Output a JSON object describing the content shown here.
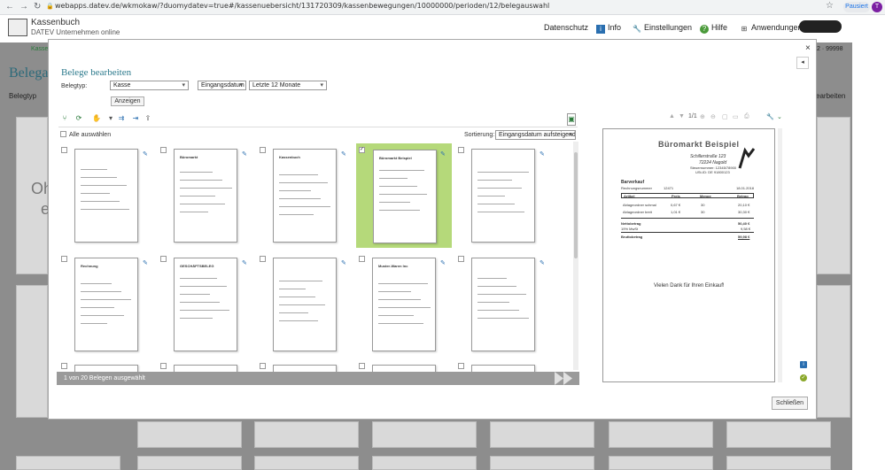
{
  "browser": {
    "url": "webapps.datev.de/wkmokaw/?duomydatev=true#/kassenuebersicht/131720309/kassenbewegungen/10000000/perioden/12/belegauswahl",
    "paused_label": "Pausiert",
    "avatar_letter": "T"
  },
  "app": {
    "title": "Kassenbuch",
    "subtitle": "DATEV Unternehmen online",
    "nav": [
      "Datenschutz",
      "Info",
      "Einstellungen",
      "Hilfe",
      "Anwendungen"
    ]
  },
  "background": {
    "tab_text": "Kassen",
    "number_text": "2 · 99998",
    "page_title": "Belega",
    "belegtyp_label": "Belegtyp",
    "arbeiten_label": "earbeiten",
    "oh_text": "Oh",
    "e_text": "e"
  },
  "modal": {
    "title": "Belege bearbeiten",
    "belegtyp_label": "Belegtyp:",
    "belegtyp_value": "Kasse",
    "date_field_value": "Eingangsdatum",
    "period_value": "Letzte 12 Monate",
    "show_button": "Anzeigen",
    "select_all_label": "Alle auswählen",
    "sort_label": "Sortierung:",
    "sort_value": "Eingangsdatum aufsteigend",
    "status_text": "1 von 20 Belegen ausgewählt",
    "close_button": "Schließen",
    "page_indicator": "1/1"
  },
  "thumbnails": {
    "total": 20,
    "selected_index": 3,
    "headings": [
      "",
      "Büromarkt",
      "Kassenbuch",
      "Büromarkt Beispiel",
      "",
      "Rechnung",
      "GESCHÄFTSBELEG",
      "",
      "Muster-Waren Inc",
      ""
    ]
  },
  "preview": {
    "company": "Büromarkt Beispiel",
    "address_lines": [
      "Schillerstraße 123",
      "72224 Nagold",
      "Steuernummer: 12345/78900",
      "USt-ID: DE 91800123"
    ],
    "doc_type": "Barverkauf",
    "receipt_label": "Rechnungsnummer",
    "receipt_no": "12471",
    "receipt_date": "18.01.2018",
    "columns": [
      "Artikel",
      "Preis",
      "Menge",
      "Betrag"
    ],
    "rows": [
      [
        "Ablageordner schmal",
        "0,67 €",
        "30",
        "20,10 €"
      ],
      [
        "Ablageordner breit",
        "1,01 €",
        "30",
        "30,30 €"
      ]
    ],
    "net_label": "Nettobetrag",
    "net_value": "50,40 €",
    "tax_label": "19% MwSt",
    "tax_value": "9,58 €",
    "gross_label": "Bruttobetrag",
    "gross_value": "59,98 €",
    "thanks": "Vielen Dank für Ihren Einkauf!"
  },
  "colors": {
    "accent": "#2c7a8c",
    "selected_thumb": "#b5d97a",
    "status_bar": "#9a9a9a"
  }
}
